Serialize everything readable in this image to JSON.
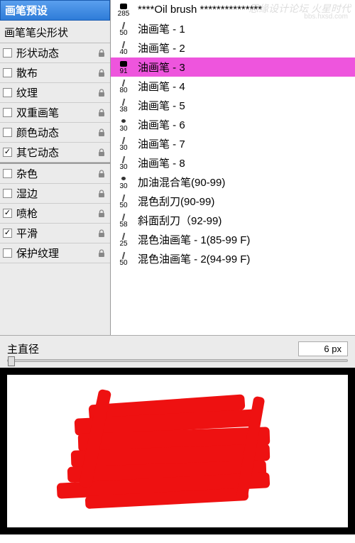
{
  "watermark": {
    "line1": "思缘设计论坛 火星时代",
    "line2": "bbs.hxsd.com"
  },
  "leftPanel": {
    "header": "画笔预设",
    "tipShape": "画笔笔尖形状",
    "options": [
      {
        "label": "形状动态",
        "checked": false,
        "lock": true
      },
      {
        "label": "散布",
        "checked": false,
        "lock": true
      },
      {
        "label": "纹理",
        "checked": false,
        "lock": true
      },
      {
        "label": "双重画笔",
        "checked": false,
        "lock": true
      },
      {
        "label": "颜色动态",
        "checked": false,
        "lock": true
      },
      {
        "label": "其它动态",
        "checked": true,
        "lock": true
      }
    ],
    "options2": [
      {
        "label": "杂色",
        "checked": false,
        "lock": true
      },
      {
        "label": "湿边",
        "checked": false,
        "lock": true
      },
      {
        "label": "喷枪",
        "checked": true,
        "lock": true
      },
      {
        "label": "平滑",
        "checked": true,
        "lock": true
      },
      {
        "label": "保护纹理",
        "checked": false,
        "lock": true
      }
    ]
  },
  "brushList": {
    "items": [
      {
        "size": "285",
        "name": "****Oil brush ***************",
        "selected": false,
        "shape": "big"
      },
      {
        "size": "50",
        "name": "油画笔 - 1",
        "selected": false,
        "shape": "line"
      },
      {
        "size": "40",
        "name": "油画笔 - 2",
        "selected": false,
        "shape": "line"
      },
      {
        "size": "91",
        "name": "油画笔 - 3",
        "selected": true,
        "shape": "big"
      },
      {
        "size": "80",
        "name": "油画笔 - 4",
        "selected": false,
        "shape": "line"
      },
      {
        "size": "38",
        "name": "油画笔 - 5",
        "selected": false,
        "shape": "line"
      },
      {
        "size": "30",
        "name": "油画笔 - 6",
        "selected": false,
        "shape": "dot"
      },
      {
        "size": "30",
        "name": "油画笔 - 7",
        "selected": false,
        "shape": "line"
      },
      {
        "size": "30",
        "name": "油画笔 - 8",
        "selected": false,
        "shape": "line"
      },
      {
        "size": "30",
        "name": "加油混合笔(90-99)",
        "selected": false,
        "shape": "dot"
      },
      {
        "size": "50",
        "name": "混色刮刀(90-99)",
        "selected": false,
        "shape": "line"
      },
      {
        "size": "58",
        "name": "斜面刮刀（92-99)",
        "selected": false,
        "shape": "line"
      },
      {
        "size": "25",
        "name": "混色油画笔 - 1(85-99 F)",
        "selected": false,
        "shape": "line"
      },
      {
        "size": "50",
        "name": "混色油画笔 - 2(94-99 F)",
        "selected": false,
        "shape": "line"
      }
    ]
  },
  "diameter": {
    "label": "主直径",
    "value": "6 px"
  }
}
